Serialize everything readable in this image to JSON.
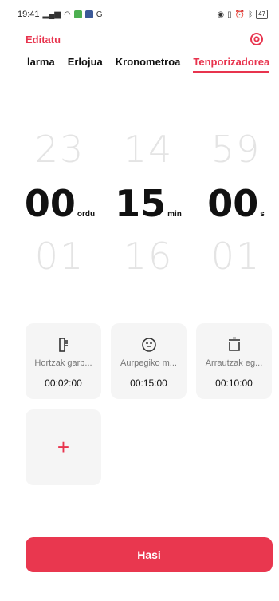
{
  "status_bar": {
    "time": "19:41",
    "battery": "47",
    "icons_left": [
      "signal-icon",
      "wifi-icon",
      "app-icon",
      "facebook-icon",
      "google-icon"
    ],
    "icons_right": [
      "nfc-icon",
      "vibrate-icon",
      "alarm-icon",
      "bluetooth-icon",
      "battery-icon"
    ]
  },
  "header": {
    "edit_label": "Editatu"
  },
  "tabs": [
    {
      "label": "larma"
    },
    {
      "label": "Erlojua"
    },
    {
      "label": "Kronometroa"
    },
    {
      "label": "Tenporizadorea",
      "active": true
    }
  ],
  "picker": {
    "hours": {
      "prev": "23",
      "value": "00",
      "next": "01",
      "unit": "ordu"
    },
    "minutes": {
      "prev": "14",
      "value": "15",
      "next": "16",
      "unit": "min"
    },
    "seconds": {
      "prev": "59",
      "value": "00",
      "next": "01",
      "unit": "s"
    }
  },
  "presets": [
    {
      "label": "Hortzak garb...",
      "time": "00:02:00",
      "icon": "toothbrush-icon"
    },
    {
      "label": "Aurpegiko m...",
      "time": "00:15:00",
      "icon": "face-mask-icon"
    },
    {
      "label": "Arrautzak eg...",
      "time": "00:10:00",
      "icon": "pot-icon"
    }
  ],
  "add_preset": {
    "label": "+"
  },
  "start_button": {
    "label": "Hasi"
  },
  "colors": {
    "accent": "#e8344e"
  }
}
